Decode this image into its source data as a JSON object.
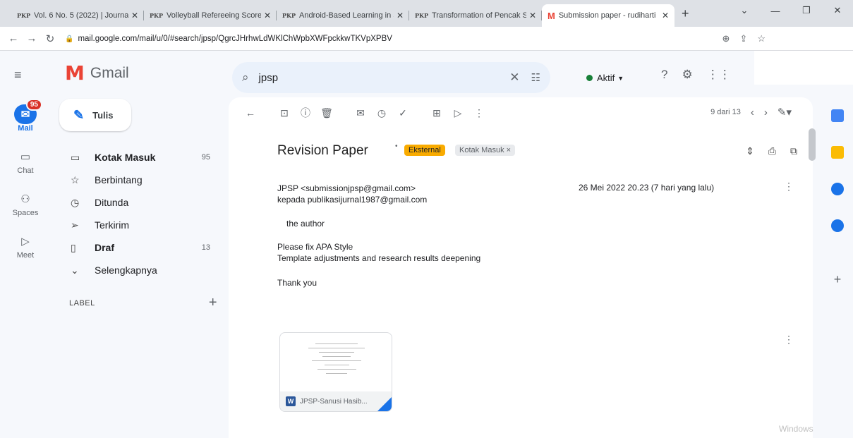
{
  "browser": {
    "tabs": [
      {
        "icon": "PKP",
        "title": "Vol. 6 No. 5 (2022) | Journal",
        "active": false
      },
      {
        "icon": "PKP",
        "title": "Volleyball Refereeing Score S",
        "active": false
      },
      {
        "icon": "PKP",
        "title": "Android-Based Learning in S",
        "active": false
      },
      {
        "icon": "PKP",
        "title": "Transformation of Pencak Sil",
        "active": false
      },
      {
        "icon": "M",
        "title": "Submission paper - rudiharti",
        "active": true
      }
    ],
    "new_tab": "+",
    "url": "mail.google.com/mail/u/0/#search/jpsp/QgrcJHrhwLdWKlChWpbXWFpckkwTKVpXPBV"
  },
  "gmail": {
    "logo_text": "Gmail",
    "search_value": "jpsp",
    "status_label": "Aktif",
    "rail": [
      {
        "label": "Mail",
        "badge": "95",
        "active": true
      },
      {
        "label": "Chat"
      },
      {
        "label": "Spaces"
      },
      {
        "label": "Meet"
      }
    ],
    "compose_label": "Tulis",
    "folders": [
      {
        "label": "Kotak Masuk",
        "count": "95",
        "bold": true
      },
      {
        "label": "Berbintang",
        "count": ""
      },
      {
        "label": "Ditunda",
        "count": ""
      },
      {
        "label": "Terkirim",
        "count": ""
      },
      {
        "label": "Draf",
        "count": "13",
        "bold": true
      },
      {
        "label": "Selengkapnya",
        "count": ""
      }
    ],
    "label_heading": "LABEL"
  },
  "message": {
    "pager": "9 dari 13",
    "subject": "Revision Paper",
    "tag_external": "Eksternal",
    "tag_inbox": "Kotak Masuk ×",
    "sender": "JPSP <submissionjpsp@gmail.com>",
    "recipient": "kepada publikasijurnal1987@gmail.com",
    "date": "26 Mei 2022 20.23 (7 hari yang lalu)",
    "greeting": "the author",
    "body_line1": "Please fix APA Style",
    "body_line2": "Template adjustments and research results deepening",
    "closing": "Thank you",
    "attachment_name": "JPSP-Sanusi Hasib..."
  },
  "watermark": "Windows"
}
